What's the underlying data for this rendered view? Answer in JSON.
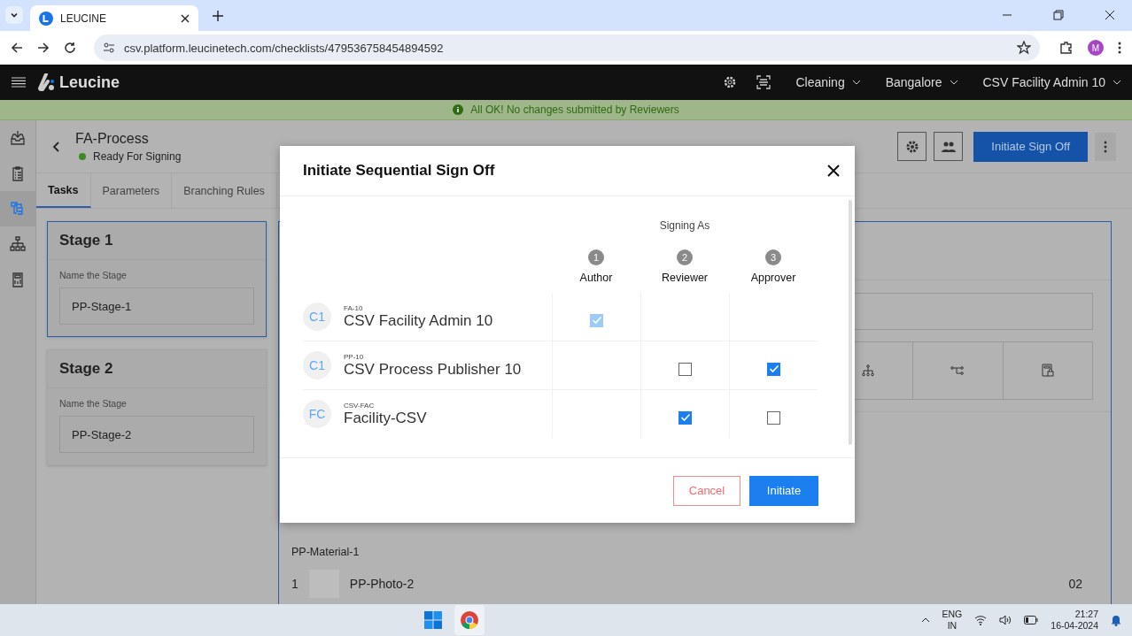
{
  "browser": {
    "tab_title": "LEUCINE",
    "url": "csv.platform.leucinetech.com/checklists/479536758454894592",
    "profile_initial": "M"
  },
  "app_header": {
    "logo": "Leucine",
    "menus": [
      {
        "label": "Cleaning"
      },
      {
        "label": "Bangalore"
      },
      {
        "label": "CSV Facility Admin 10"
      }
    ]
  },
  "banner": "All OK! No changes submitted by Reviewers",
  "sidebar": {
    "items": [
      {
        "selected": false
      },
      {
        "selected": false
      },
      {
        "selected": true
      },
      {
        "selected": false
      },
      {
        "selected": false
      }
    ]
  },
  "page": {
    "title": "FA-Process",
    "status": "Ready For Signing",
    "primary_button": "Initiate Sign Off",
    "tabs": [
      {
        "label": "Tasks",
        "selected": true
      },
      {
        "label": "Parameters",
        "selected": false
      },
      {
        "label": "Branching Rules",
        "selected": false
      }
    ],
    "stages": [
      {
        "title": "Stage 1",
        "field_label": "Name the Stage",
        "value": "PP-Stage-1",
        "selected": true
      },
      {
        "title": "Stage 2",
        "field_label": "Name the Stage",
        "value": "PP-Stage-2",
        "selected": false
      }
    ],
    "material": {
      "name": "PP-Material-1",
      "rows": [
        {
          "index": "1",
          "name": "PP-Photo-2",
          "quantity": "02"
        }
      ]
    }
  },
  "modal": {
    "title": "Initiate Sequential Sign Off",
    "signing_as": "Signing As",
    "roles": [
      {
        "number": "1",
        "label": "Author"
      },
      {
        "number": "2",
        "label": "Reviewer"
      },
      {
        "number": "3",
        "label": "Approver"
      }
    ],
    "users": [
      {
        "initials": "C1",
        "code": "FA-10",
        "name": "CSV Facility Admin 10",
        "cells": [
          {
            "kind": "checkbox",
            "checked": true,
            "disabled": true
          },
          {
            "kind": "empty"
          },
          {
            "kind": "empty"
          }
        ]
      },
      {
        "initials": "C1",
        "code": "PP-10",
        "name": "CSV Process Publisher 10",
        "cells": [
          {
            "kind": "empty"
          },
          {
            "kind": "checkbox",
            "checked": false,
            "disabled": false
          },
          {
            "kind": "checkbox",
            "checked": true,
            "disabled": false
          }
        ]
      },
      {
        "initials": "FC",
        "code": "CSV-FAC",
        "name": "Facility-CSV",
        "cells": [
          {
            "kind": "empty"
          },
          {
            "kind": "checkbox",
            "checked": true,
            "disabled": false
          },
          {
            "kind": "checkbox",
            "checked": false,
            "disabled": false
          }
        ]
      }
    ],
    "cancel": "Cancel",
    "confirm": "Initiate"
  },
  "taskbar": {
    "language": "ENG",
    "region": "IN",
    "time": "21:27",
    "date": "16-04-2024"
  }
}
